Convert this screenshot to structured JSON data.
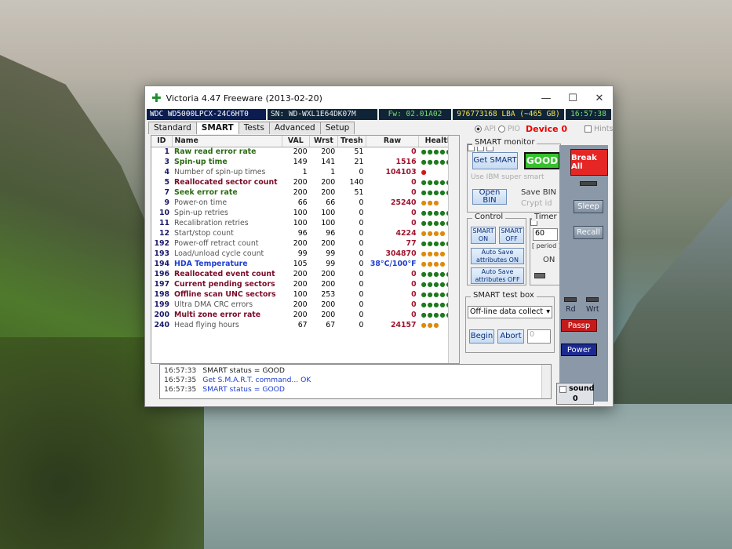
{
  "window": {
    "title": "Victoria 4.47  Freeware (2013-02-20)",
    "controls": {
      "minimize": "—",
      "maximize": "☐",
      "close": "✕"
    }
  },
  "infobar": {
    "model": "WDC WD5000LPCX-24C6HT0",
    "sn": "SN: WD-WXL1E64DK07M",
    "fw": "Fw: 02.01A02",
    "lba": "976773168 LBA (~465 GB)",
    "time": "16:57:38"
  },
  "tabs": [
    "Standard",
    "SMART",
    "Tests",
    "Advanced",
    "Setup"
  ],
  "api": {
    "api_label": "API",
    "pio_label": "PIO",
    "device": "Device 0",
    "hints": "Hints"
  },
  "table": {
    "headers": [
      "ID",
      "Name",
      "VAL",
      "Wrst",
      "Tresh",
      "Raw",
      "Health"
    ],
    "rows": [
      {
        "id": "1",
        "name": "Raw read error rate",
        "val": "200",
        "wrst": "200",
        "tresh": "51",
        "raw": "0",
        "health": "●●●●●",
        "name_class": "n-critical",
        "health_class": "h-green"
      },
      {
        "id": "3",
        "name": "Spin-up time",
        "val": "149",
        "wrst": "141",
        "tresh": "21",
        "raw": "1516",
        "health": "●●●●●",
        "name_class": "n-critical",
        "health_class": "h-green"
      },
      {
        "id": "4",
        "name": "Number of spin-up times",
        "val": "1",
        "wrst": "1",
        "tresh": "0",
        "raw": "104103",
        "health": "●",
        "name_class": "n-normal",
        "health_class": "h-red"
      },
      {
        "id": "5",
        "name": "Reallocated sector count",
        "val": "200",
        "wrst": "200",
        "tresh": "140",
        "raw": "0",
        "health": "●●●●●",
        "name_class": "n-warn",
        "health_class": "h-green"
      },
      {
        "id": "7",
        "name": "Seek error rate",
        "val": "200",
        "wrst": "200",
        "tresh": "51",
        "raw": "0",
        "health": "●●●●●",
        "name_class": "n-critical",
        "health_class": "h-green"
      },
      {
        "id": "9",
        "name": "Power-on time",
        "val": "66",
        "wrst": "66",
        "tresh": "0",
        "raw": "25240",
        "health": "●●●",
        "name_class": "n-normal",
        "health_class": "h-orange"
      },
      {
        "id": "10",
        "name": "Spin-up retries",
        "val": "100",
        "wrst": "100",
        "tresh": "0",
        "raw": "0",
        "health": "●●●●●",
        "name_class": "n-normal",
        "health_class": "h-green"
      },
      {
        "id": "11",
        "name": "Recalibration retries",
        "val": "100",
        "wrst": "100",
        "tresh": "0",
        "raw": "0",
        "health": "●●●●●",
        "name_class": "n-normal",
        "health_class": "h-green"
      },
      {
        "id": "12",
        "name": "Start/stop count",
        "val": "96",
        "wrst": "96",
        "tresh": "0",
        "raw": "4224",
        "health": "●●●●",
        "name_class": "n-normal",
        "health_class": "h-orange"
      },
      {
        "id": "192",
        "name": "Power-off retract count",
        "val": "200",
        "wrst": "200",
        "tresh": "0",
        "raw": "77",
        "health": "●●●●●",
        "name_class": "n-normal",
        "health_class": "h-green"
      },
      {
        "id": "193",
        "name": "Load/unload cycle count",
        "val": "99",
        "wrst": "99",
        "tresh": "0",
        "raw": "304870",
        "health": "●●●●",
        "name_class": "n-normal",
        "health_class": "h-orange"
      },
      {
        "id": "194",
        "name": "HDA Temperature",
        "val": "105",
        "wrst": "99",
        "tresh": "0",
        "raw": "38°C/100°F",
        "health": "●●●●",
        "name_class": "n-blue",
        "health_class": "h-orange",
        "raw_class": "raw-blue"
      },
      {
        "id": "196",
        "name": "Reallocated event count",
        "val": "200",
        "wrst": "200",
        "tresh": "0",
        "raw": "0",
        "health": "●●●●●",
        "name_class": "n-warn",
        "health_class": "h-green"
      },
      {
        "id": "197",
        "name": "Current pending sectors",
        "val": "200",
        "wrst": "200",
        "tresh": "0",
        "raw": "0",
        "health": "●●●●●",
        "name_class": "n-warn",
        "health_class": "h-green"
      },
      {
        "id": "198",
        "name": "Offline scan UNC sectors",
        "val": "100",
        "wrst": "253",
        "tresh": "0",
        "raw": "0",
        "health": "●●●●●",
        "name_class": "n-warn",
        "health_class": "h-green"
      },
      {
        "id": "199",
        "name": "Ultra DMA CRC errors",
        "val": "200",
        "wrst": "200",
        "tresh": "0",
        "raw": "0",
        "health": "●●●●●",
        "name_class": "n-normal",
        "health_class": "h-green"
      },
      {
        "id": "200",
        "name": "Multi zone error rate",
        "val": "200",
        "wrst": "200",
        "tresh": "0",
        "raw": "0",
        "health": "●●●●●",
        "name_class": "n-warn",
        "health_class": "h-green"
      },
      {
        "id": "240",
        "name": "Head flying hours",
        "val": "67",
        "wrst": "67",
        "tresh": "0",
        "raw": "24157",
        "health": "●●●",
        "name_class": "n-normal",
        "health_class": "h-orange"
      }
    ]
  },
  "smart_monitor": {
    "title": "SMART monitor",
    "get_smart": "Get SMART",
    "status": "GOOD",
    "ibm_label": "Use IBM super smart",
    "open_bin": "Open BIN",
    "save_bin": "Save BIN",
    "crypt": "Crypt id"
  },
  "control": {
    "title": "Control",
    "smart_on": "SMART ON",
    "smart_off": "SMART OFF",
    "autosave_on": "Auto Save attributes ON",
    "autosave_off": "Auto Save attributes OFF"
  },
  "timer": {
    "title": "Timer",
    "value": "60",
    "period": "[ period ]",
    "on": "ON"
  },
  "test_box": {
    "title": "SMART test box",
    "selected": "Off-line data collect",
    "begin": "Begin",
    "abort": "Abort",
    "value": "0"
  },
  "sidebar": {
    "break_all": "Break All",
    "sleep": "Sleep",
    "recall": "Recall",
    "rd": "Rd",
    "wrt": "Wrt",
    "passp": "Passp",
    "power": "Power",
    "sound": "sound",
    "sound_value": "0"
  },
  "log": [
    {
      "time": "16:57:33",
      "msg": "SMART status = GOOD"
    },
    {
      "time": "16:57:35",
      "msg": "Get S.M.A.R.T. command... OK"
    },
    {
      "time": "16:57:35",
      "msg": "SMART status = GOOD"
    }
  ]
}
